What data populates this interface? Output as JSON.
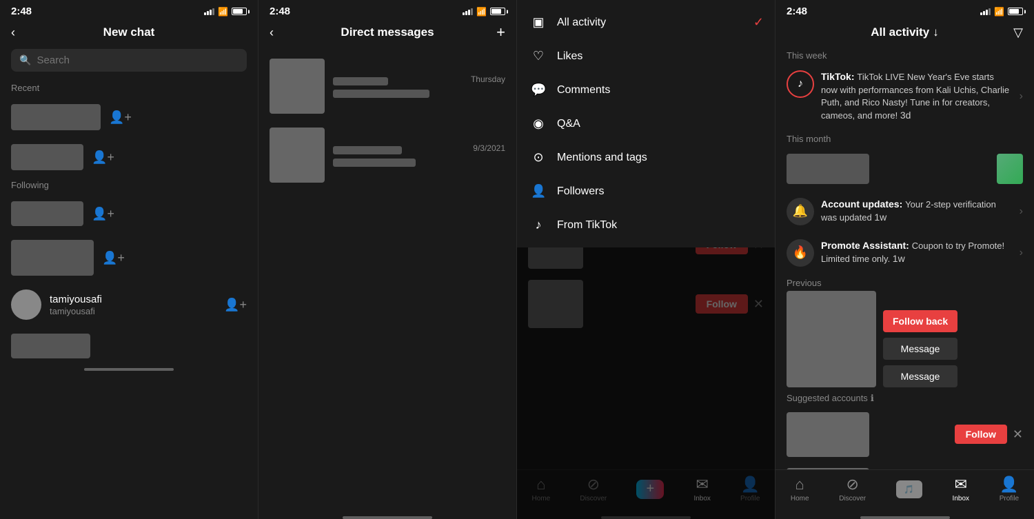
{
  "panels": {
    "p1": {
      "title": "New chat",
      "search_placeholder": "Search",
      "sections": {
        "recent_label": "Recent",
        "following_label": "Following"
      },
      "contacts": [
        {
          "name": "",
          "handle": "",
          "has_avatar": false
        },
        {
          "name": "",
          "handle": "",
          "has_avatar": false
        },
        {
          "name": "",
          "handle": "",
          "has_avatar": false
        },
        {
          "name": "",
          "handle": "",
          "has_avatar": false
        },
        {
          "name": "tamiyousafi",
          "handle": "tamiyousafi",
          "has_avatar": true
        }
      ]
    },
    "p2": {
      "title": "Direct messages",
      "messages": [
        {
          "date": "Thursday",
          "preview_hidden": true
        },
        {
          "date": "9/3/2021",
          "preview_hidden": true
        }
      ]
    },
    "p3": {
      "title": "All activity",
      "title_caret": "^",
      "dropdown_items": [
        {
          "label": "All activity",
          "icon": "▣",
          "checked": true
        },
        {
          "label": "Likes",
          "icon": "♡",
          "checked": false
        },
        {
          "label": "Comments",
          "icon": "💬",
          "checked": false
        },
        {
          "label": "Q&A",
          "icon": "◉",
          "checked": false
        },
        {
          "label": "Mentions and tags",
          "icon": "⊙",
          "checked": false
        },
        {
          "label": "Followers",
          "icon": "👤",
          "checked": false
        },
        {
          "label": "From TikTok",
          "icon": "♪",
          "checked": false
        }
      ],
      "followers_section": {
        "label": "Previous",
        "follow_back_label": "Follow back",
        "message_labels": [
          "Message",
          "Message"
        ]
      },
      "suggested_label": "Suggested accounts",
      "follow_label": "Follow",
      "bottom_nav": {
        "items": [
          "Home",
          "Discover",
          "",
          "Inbox",
          "Profile"
        ]
      }
    },
    "p4": {
      "title": "All activity",
      "title_caret": "↓",
      "this_week_label": "This week",
      "this_month_label": "This month",
      "previous_label": "Previous",
      "notifications": [
        {
          "type": "tiktok",
          "title": "TikTok:",
          "body": "TikTok LIVE New Year's Eve starts now with performances from Kali Uchis, Charlie Puth, and Rico Nasty! Tune in for creators, cameos, and more!",
          "age": "3d"
        },
        {
          "type": "account",
          "icon": "🔔",
          "title": "Account updates:",
          "body": "Your 2-step verification was updated",
          "age": "1w"
        },
        {
          "type": "promote",
          "icon": "🔥",
          "title": "Promote Assistant:",
          "body": "Coupon to try Promote! Limited time only.",
          "age": "1w"
        }
      ],
      "followers_section": {
        "label": "Previous",
        "follow_back_label": "Follow back",
        "message_labels": [
          "Message",
          "Message"
        ]
      },
      "suggested_label": "Suggested accounts",
      "follow_labels": [
        "Follow",
        "Follow"
      ],
      "bottom_nav": {
        "items": [
          "Home",
          "Discover",
          "",
          "Inbox",
          "Profile"
        ]
      }
    }
  },
  "status_bar": {
    "time": "2:48"
  }
}
